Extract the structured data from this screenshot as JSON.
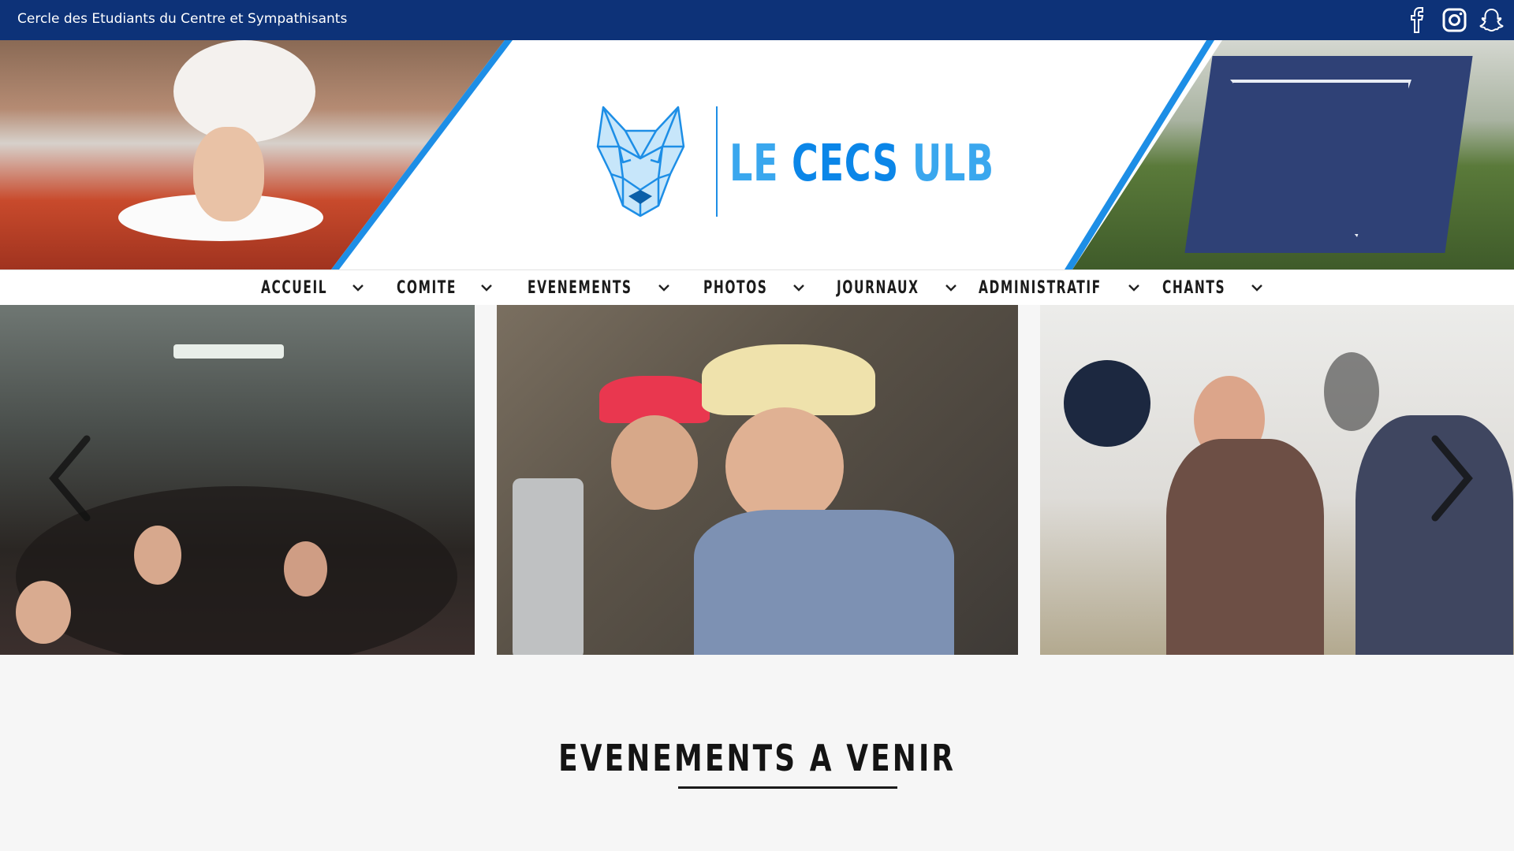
{
  "topbar": {
    "org_name": "Cercle des Etudiants du Centre et Sympathisants",
    "social": [
      {
        "icon": "facebook-icon"
      },
      {
        "icon": "instagram-icon"
      },
      {
        "icon": "snapchat-icon"
      }
    ],
    "bg_color": "#0d3278"
  },
  "banner": {
    "brand_part1": "LE",
    "brand_part2": "CECS",
    "brand_part3": "ULB",
    "logo_icon": "wolf-logo-icon",
    "accent_color": "#1d8ee6"
  },
  "nav": {
    "items": [
      {
        "label": "ACCUEIL"
      },
      {
        "label": "COMITE"
      },
      {
        "label": "EVENEMENTS"
      },
      {
        "label": "PHOTOS"
      },
      {
        "label": "JOURNAUX"
      },
      {
        "label": "ADMINISTRATIF"
      },
      {
        "label": "CHANTS"
      }
    ]
  },
  "slider": {
    "prev_icon": "chevron-left-icon",
    "next_icon": "chevron-right-icon"
  },
  "events": {
    "title": "EVENEMENTS A VENIR"
  }
}
